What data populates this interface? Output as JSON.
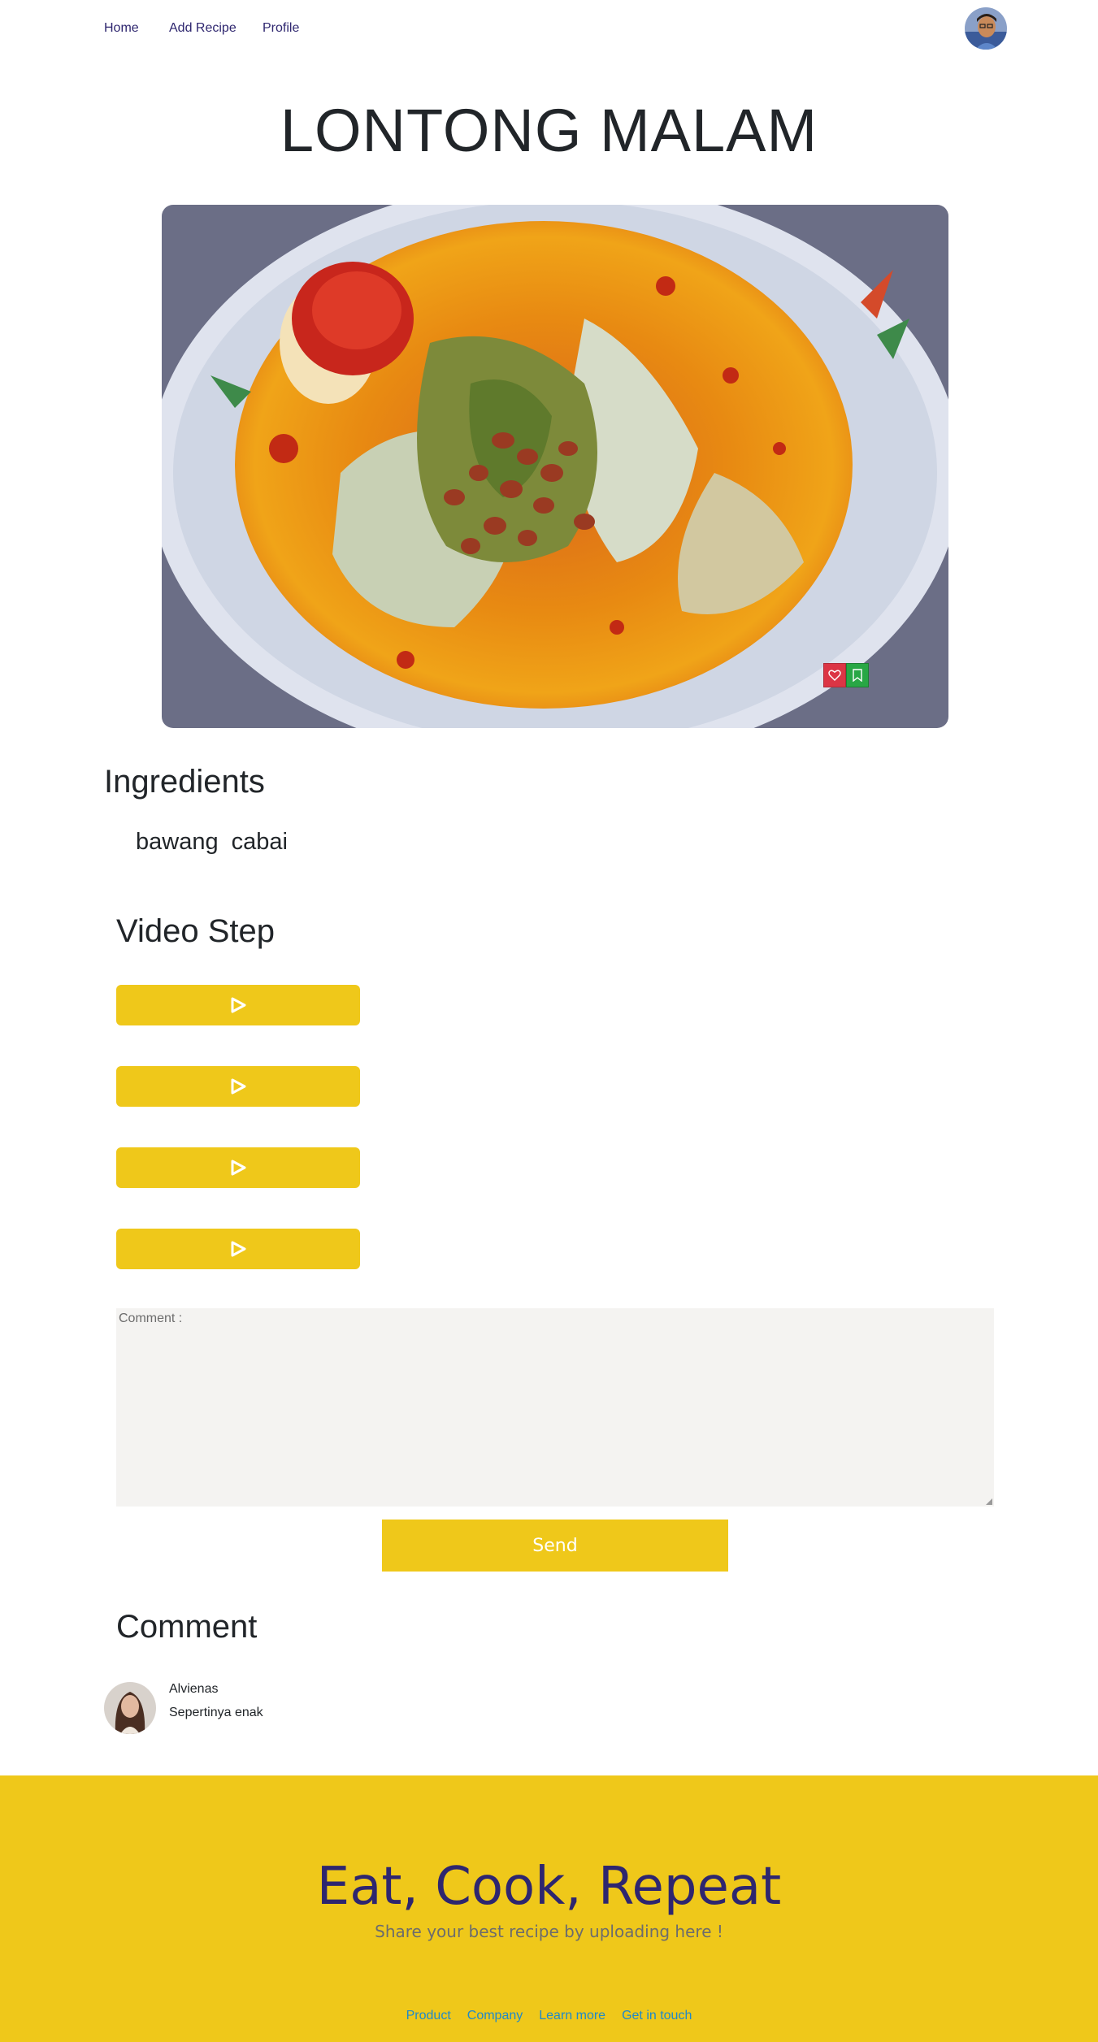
{
  "nav": {
    "home": "Home",
    "add_recipe": "Add Recipe",
    "profile": "Profile",
    "avatar_icon": "user-avatar-icon"
  },
  "recipe": {
    "title": "LONTONG MALAM",
    "image_icon": "food-photo",
    "like_icon": "heart-icon",
    "save_icon": "bookmark-icon"
  },
  "ingredients": {
    "heading": "Ingredients",
    "items": [
      "bawang",
      "cabai"
    ]
  },
  "video_step": {
    "heading": "Video Step",
    "buttons": [
      {
        "icon": "play-icon"
      },
      {
        "icon": "play-icon"
      },
      {
        "icon": "play-icon"
      },
      {
        "icon": "play-icon"
      }
    ]
  },
  "comment_form": {
    "placeholder": "Comment :",
    "value": "",
    "send_label": "Send"
  },
  "comments": {
    "heading": "Comment",
    "items": [
      {
        "author": "Alvienas",
        "text": "Sepertinya enak",
        "avatar_icon": "user-avatar-icon"
      }
    ]
  },
  "footer": {
    "title": "Eat, Cook, Repeat",
    "subtitle": "Share your best recipe by uploading here !",
    "links": [
      "Product",
      "Company",
      "Learn more",
      "Get in touch"
    ]
  },
  "colors": {
    "accent_yellow": "#efc81a",
    "nav_text": "#2e266f",
    "footer_link": "#1f89c9",
    "like_red": "#dc3545",
    "save_green": "#28a745"
  }
}
